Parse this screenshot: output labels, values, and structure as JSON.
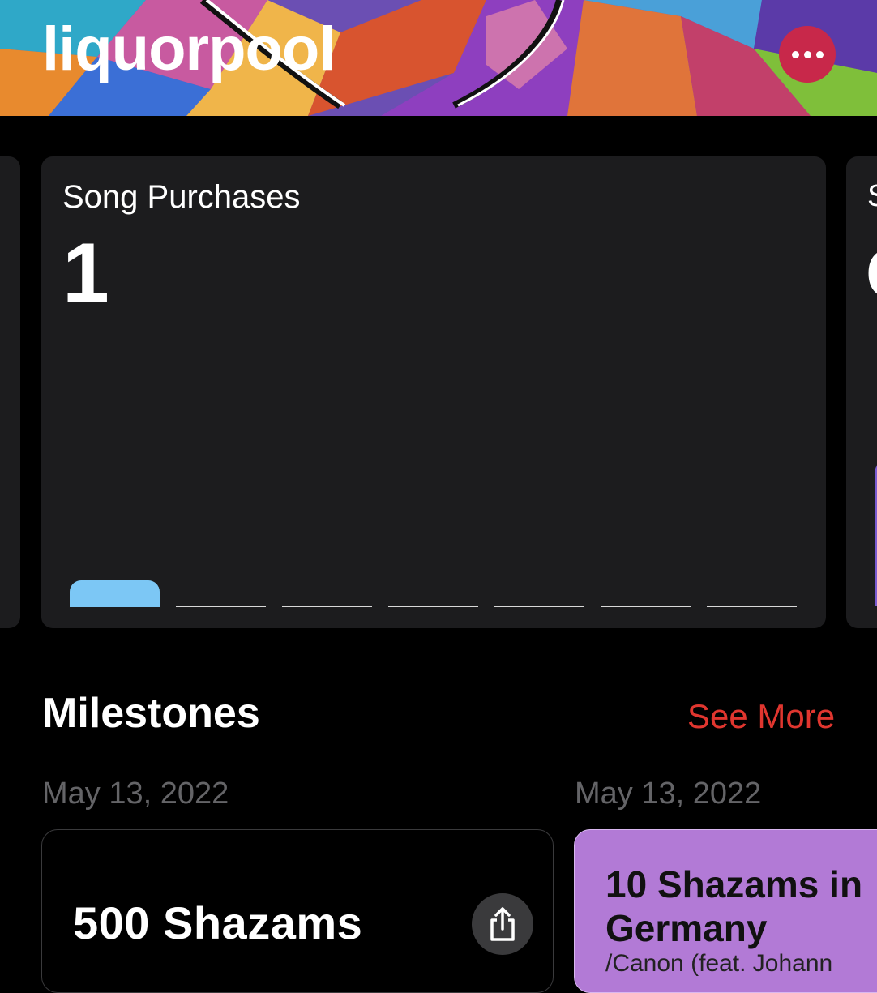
{
  "header": {
    "artist_name": "liquorpool",
    "more_icon": "ellipsis-icon",
    "more_button_color": "#c8284a"
  },
  "stats": {
    "current": {
      "title": "Song Purchases",
      "value": "1"
    },
    "next": {
      "title": "S",
      "value": "C"
    },
    "bar_color": "#7cc7f5",
    "bars": [
      1,
      0,
      0,
      0,
      0,
      0,
      0
    ]
  },
  "milestones": {
    "title": "Milestones",
    "see_more": "See More",
    "accent_color": "#e0362f",
    "items": [
      {
        "date": "May 13, 2022",
        "title": "500 Shazams",
        "share_icon": "share-icon"
      },
      {
        "date": "May 13, 2022",
        "title": "10 Shazams in Germany",
        "subtitle": "/Canon (feat. Johann",
        "color": "#b27ad6"
      }
    ]
  }
}
